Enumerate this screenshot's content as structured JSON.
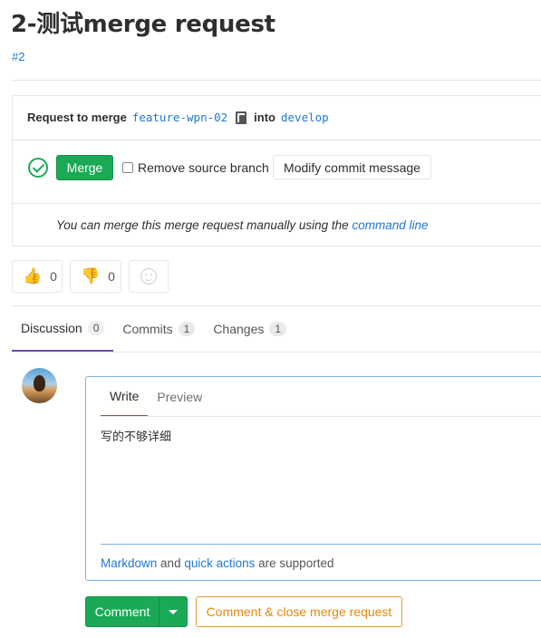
{
  "title": "2-测试merge request",
  "mr_id": "#2",
  "widget": {
    "request_label": "Request to merge",
    "source_branch": "feature-wpn-02",
    "into_label": "into",
    "target_branch": "develop",
    "merge_button": "Merge",
    "remove_source_branch": "Remove source branch",
    "modify_commit_message": "Modify commit message",
    "manual_text": "You can merge this merge request manually using the",
    "command_line_link": "command line"
  },
  "awards": {
    "thumbsup_count": "0",
    "thumbsdown_count": "0"
  },
  "tabs": [
    {
      "label": "Discussion",
      "count": "0"
    },
    {
      "label": "Commits",
      "count": "1"
    },
    {
      "label": "Changes",
      "count": "1"
    }
  ],
  "editor": {
    "write_tab": "Write",
    "preview_tab": "Preview",
    "text": "写的不够详细",
    "markdown_link": "Markdown",
    "and": "and",
    "quick_actions_link": "quick actions",
    "supported": "are supported"
  },
  "actions": {
    "comment": "Comment",
    "comment_close": "Comment & close merge request"
  },
  "colors": {
    "success": "#1aaa55",
    "link": "#1f78d1",
    "active_tab": "#6b4fbb",
    "warning": "#e8890a"
  }
}
